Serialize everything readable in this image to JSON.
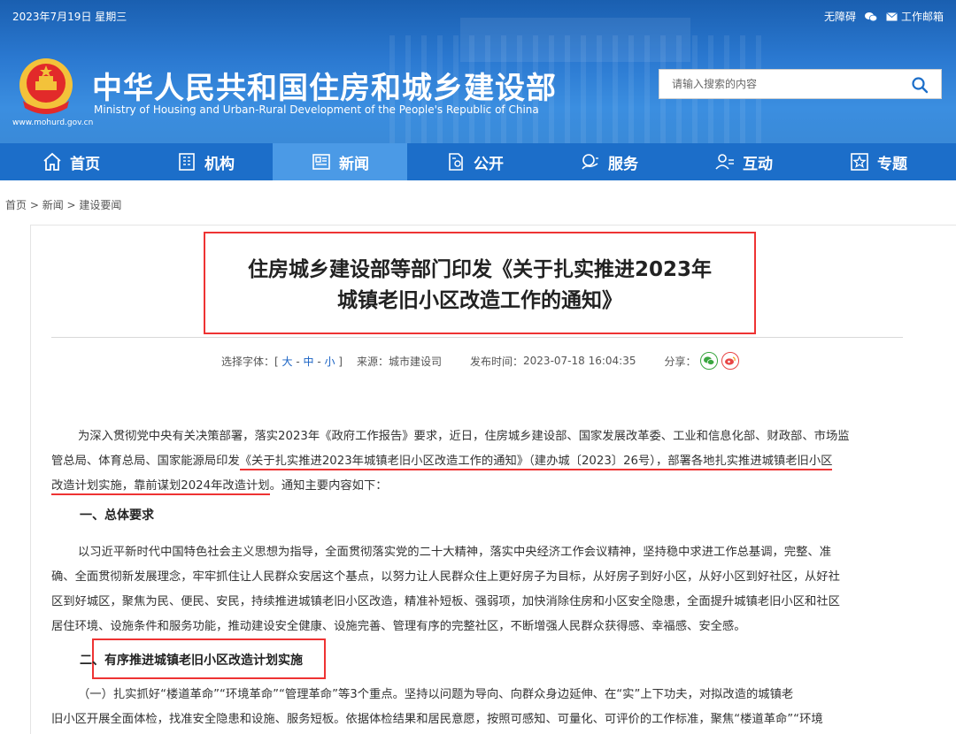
{
  "topbar": {
    "date": "2023年7月19日 星期三",
    "accessibility": "无障碍",
    "mail": "工作邮箱"
  },
  "site": {
    "title_cn": "中华人民共和国住房和城乡建设部",
    "title_en": "Ministry of Housing and Urban-Rural Development of the People's Republic of China",
    "url": "www.mohurd.gov.cn"
  },
  "search": {
    "placeholder": "请输入搜索的内容",
    "icon": "search-icon"
  },
  "nav": {
    "items": [
      {
        "label": "首页",
        "icon": "home-icon"
      },
      {
        "label": "机构",
        "icon": "building-icon"
      },
      {
        "label": "新闻",
        "icon": "newspaper-icon"
      },
      {
        "label": "公开",
        "icon": "document-icon"
      },
      {
        "label": "服务",
        "icon": "service-icon"
      },
      {
        "label": "互动",
        "icon": "people-icon"
      },
      {
        "label": "专题",
        "icon": "star-icon"
      }
    ],
    "active_index": 2
  },
  "breadcrumb": {
    "home": "首页",
    "news": "新闻",
    "current": "建设要闻",
    "sep": " > "
  },
  "article": {
    "title_line1": "住房城乡建设部等部门印发《关于扎实推进2023年",
    "title_line2": "城镇老旧小区改造工作的通知》",
    "meta": {
      "font_label": "选择字体：[ ",
      "font_large": "大",
      "font_medium": "中",
      "font_small": "小",
      "font_dash": " - ",
      "font_close": " ]",
      "source_label": "来源：",
      "source": "城市建设司",
      "time_label": "发布时间：",
      "time": "2023-07-18 16:04:35",
      "share_label": "分享："
    },
    "p1_line1": "为深入贯彻党中央有关决策部署，落实2023年《政府工作报告》要求，近日，住房城乡建设部、国家发展改革委、工业和信息化部、财政部、市场监",
    "p1_line2_a": "管总局、体育总局、国家能源局印发",
    "p1_line2_b": "《关于扎实推进2023年城镇老旧小区改造工作的通知》（建办城〔2023〕26号），部署各地扎实推进城镇老旧小区",
    "p1_line3_a": "改造计划实施，靠前谋划2024年改造计划",
    "p1_line3_b": "。通知主要内容如下：",
    "heading1": "一、总体要求",
    "p2_line1": "以习近平新时代中国特色社会主义思想为指导，全面贯彻落实党的二十大精神，落实中央经济工作会议精神，坚持稳中求进工作总基调，完整、准",
    "p2_line2": "确、全面贯彻新发展理念，牢牢抓住让人民群众安居这个基点，以努力让人民群众住上更好房子为目标，从好房子到好小区，从好小区到好社区，从好社",
    "p2_line3": "区到好城区，聚焦为民、便民、安民，持续推进城镇老旧小区改造，精准补短板、强弱项，加快消除住房和小区安全隐患，全面提升城镇老旧小区和社区",
    "p2_line4": "居住环境、设施条件和服务功能，推动建设安全健康、设施完善、管理有序的完整社区，不断增强人民群众获得感、幸福感、安全感。",
    "heading2": "二、有序推进城镇老旧小区改造计划实施",
    "p3_line1": "（一）扎实抓好“楼道革命”“环境革命”“管理革命”等3个重点。坚持以问题为导向、向群众身边延伸、在“实”上下功夫，对拟改造的城镇老",
    "p3_line2": "旧小区开展全面体检，找准安全隐患和设施、服务短板。依据体检结果和居民意愿，按照可感知、可量化、可评价的工作标准，聚焦“楼道革命”“环境"
  },
  "colors": {
    "header_blue": "#2a78d0",
    "nav_blue": "#1c6ec9",
    "nav_active": "#4b9ae6",
    "highlight_red": "#e33",
    "link_blue": "#1a63c4"
  }
}
